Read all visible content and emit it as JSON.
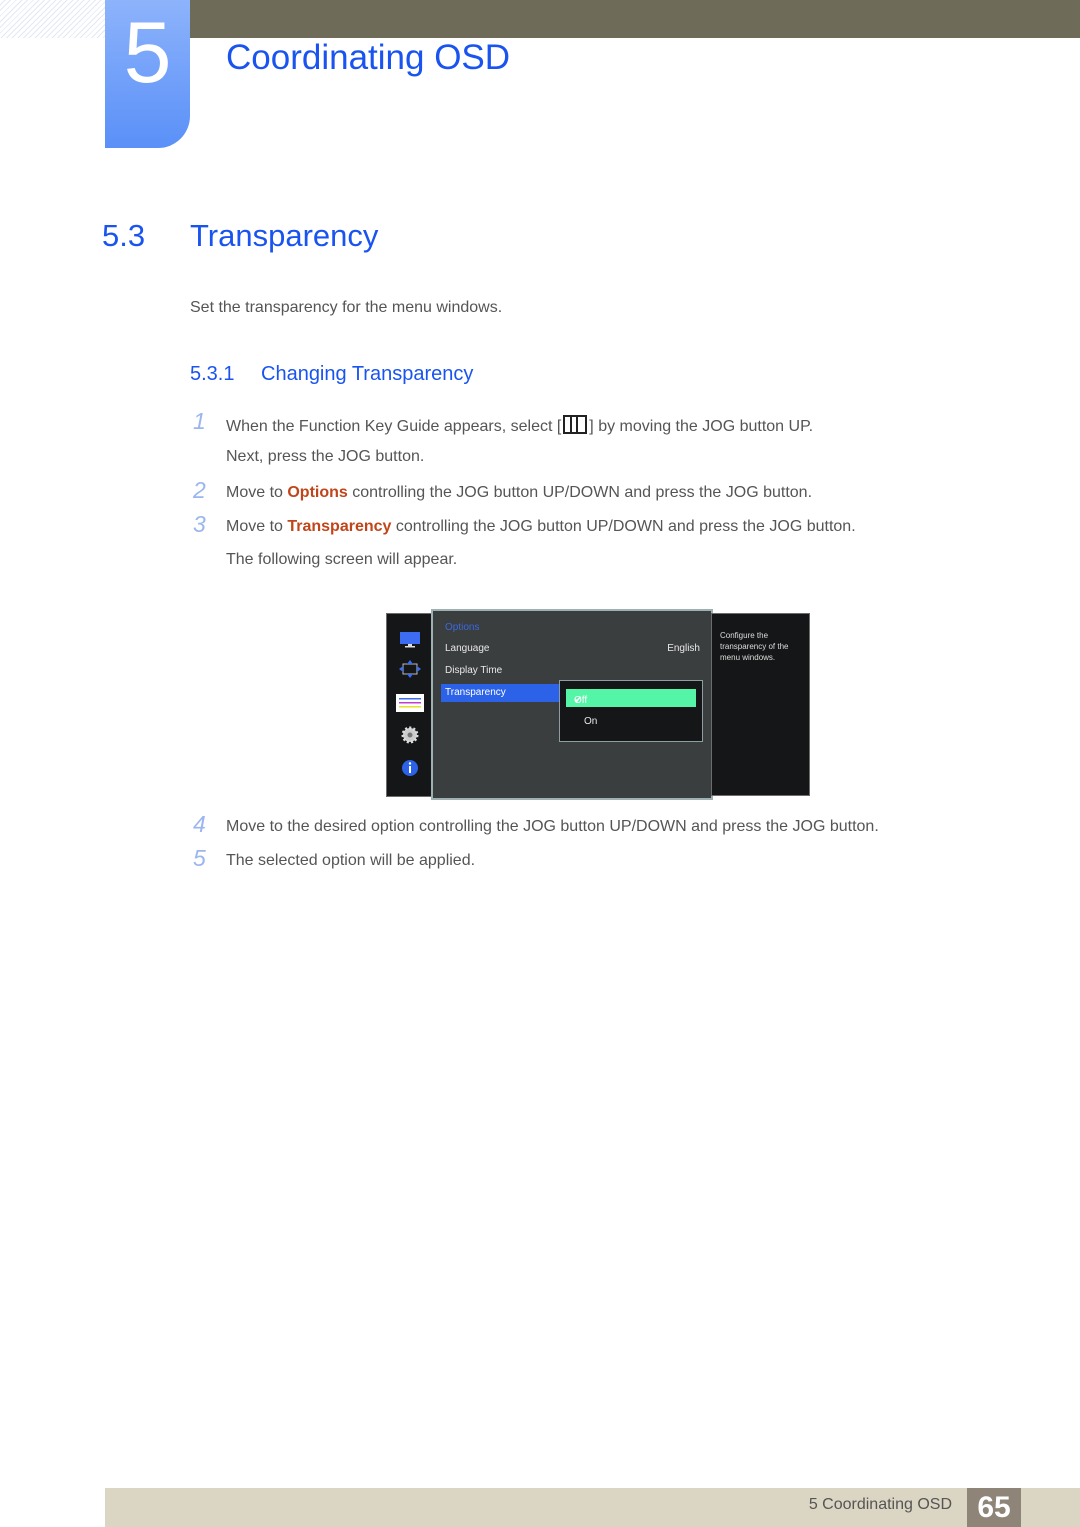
{
  "chapter": {
    "number": "5",
    "title": "Coordinating OSD"
  },
  "section": {
    "number": "5.3",
    "title": "Transparency",
    "intro": "Set the transparency for the menu windows."
  },
  "subsection": {
    "number": "5.3.1",
    "title": "Changing Transparency"
  },
  "steps": [
    {
      "num": "1",
      "pre": "When the Function Key Guide appears, select [",
      "post": "] by moving the JOG button UP.",
      "line2": "Next, press the JOG button.",
      "icon": "menu-key-icon"
    },
    {
      "num": "2",
      "pre": "Move to ",
      "hl": "Options",
      "post": " controlling the JOG button UP/DOWN and press the JOG button."
    },
    {
      "num": "3",
      "pre": "Move to ",
      "hl": "Transparency",
      "post": " controlling the JOG button UP/DOWN and press the JOG button.",
      "line2": "The following screen will appear."
    },
    {
      "num": "4",
      "text": "Move to the desired option controlling the JOG button UP/DOWN and press the JOG button."
    },
    {
      "num": "5",
      "text": "The selected option will be applied."
    }
  ],
  "osd": {
    "sidebar_icons": [
      "picture-icon",
      "position-icon",
      "options-icon",
      "settings-gear-icon",
      "info-icon"
    ],
    "menu_title": "Options",
    "items": [
      {
        "label": "Language",
        "value": "English"
      },
      {
        "label": "Display Time",
        "value": ""
      },
      {
        "label": "Transparency",
        "value": ""
      }
    ],
    "selected_item": "Transparency",
    "submenu": {
      "options": [
        "Off",
        "On"
      ],
      "selected": "Off",
      "check": "✔"
    },
    "help": "Configure the transparency of the menu windows."
  },
  "footer": {
    "label": "5 Coordinating OSD",
    "page": "65"
  },
  "colors": {
    "heading_blue": "#1a54f0",
    "highlight": "#c1451a",
    "osd_select": "#2c62e8",
    "osd_option_select": "#55f5a8"
  }
}
